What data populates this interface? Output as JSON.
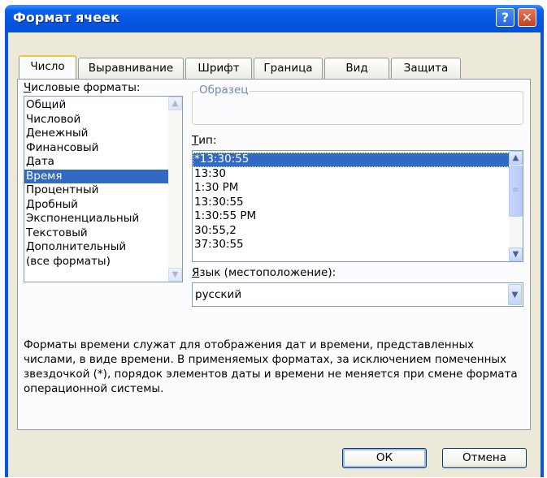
{
  "window": {
    "title": "Формат ячеек",
    "help_label": "?",
    "close_label": "✕"
  },
  "tabs": [
    "Число",
    "Выравнивание",
    "Шрифт",
    "Граница",
    "Вид",
    "Защита"
  ],
  "active_tab": "Число",
  "formats": {
    "label_underlined": "Ч",
    "label_rest": "исловые форматы:",
    "items": [
      "Общий",
      "Числовой",
      "Денежный",
      "Финансовый",
      "Дата",
      "Время",
      "Процентный",
      "Дробный",
      "Экспоненциальный",
      "Текстовый",
      "Дополнительный",
      "(все форматы)"
    ],
    "selected": "Время"
  },
  "sample": {
    "legend": "Образец",
    "value": ""
  },
  "type": {
    "label_underlined": "Т",
    "label_rest": "ип:",
    "items": [
      "*13:30:55",
      "13:30",
      "1:30 PM",
      "13:30:55",
      "1:30:55 PM",
      "30:55,2",
      "37:30:55"
    ],
    "selected": "*13:30:55"
  },
  "locale": {
    "label_underlined": "Я",
    "label_rest": "зык (местоположение):",
    "value": "русский"
  },
  "description": "Форматы времени служат для отображения дат и времени, представленных числами, в виде времени. В применяемых форматах, за исключением помеченных звездочкой (*), порядок элементов даты и времени не меняется при смене формата операционной системы.",
  "buttons": {
    "ok": "ОК",
    "cancel": "Отмена"
  },
  "icons": {
    "scroll_up": "▲",
    "scroll_down": "▼",
    "grip": "≡",
    "combo_arrow": "▼"
  },
  "colors": {
    "title_bar": "#0a55d8",
    "selection": "#316ac5",
    "active_tab_accent": "#f3c343",
    "dialog_bg": "#ece9d8"
  }
}
